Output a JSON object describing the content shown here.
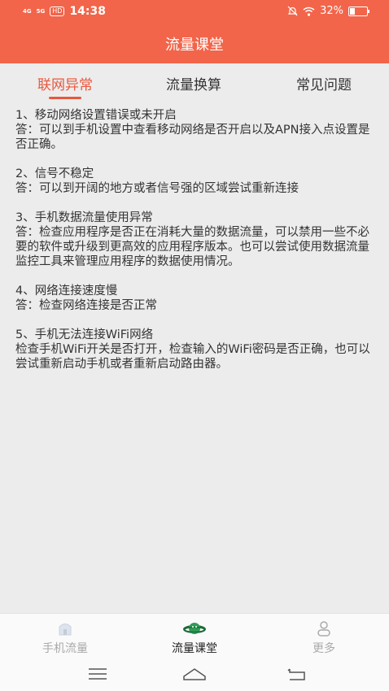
{
  "status_bar": {
    "signal1": "4G",
    "signal2": "5G",
    "hd": "HD",
    "time": "14:38",
    "battery": "32%",
    "battery_level": 0.32
  },
  "header": {
    "title": "流量课堂"
  },
  "tabs": [
    {
      "label": "联网异常",
      "active": true
    },
    {
      "label": "流量换算",
      "active": false
    },
    {
      "label": "常见问题",
      "active": false
    }
  ],
  "accent": "#f2654a",
  "content": [
    {
      "title": "1、移动网络设置错误或未开启",
      "answer": "答：可以到手机设置中查看移动网络是否开启以及APN接入点设置是否正确。"
    },
    {
      "title": "2、信号不稳定",
      "answer": "答：可以到开阔的地方或者信号强的区域尝试重新连接"
    },
    {
      "title": "3、手机数据流量使用异常",
      "answer": "答：检查应用程序是否正在消耗大量的数据流量，可以禁用一些不必要的软件或升级到更高效的应用程序版本。也可以尝试使用数据流量监控工具来管理应用程序的数据使用情况。"
    },
    {
      "title": "4、网络连接速度慢",
      "answer": "答：检查网络连接是否正常"
    },
    {
      "title": "5、手机无法连接WiFi网络",
      "answer": "检查手机WiFi开关是否打开，检查输入的WiFi密码是否正确，也可以尝试重新启动手机或者重新启动路由器。"
    }
  ],
  "bottom_nav": [
    {
      "label": "手机流量",
      "icon": "phone-data-icon",
      "active": false
    },
    {
      "label": "流量课堂",
      "icon": "planet-icon",
      "active": true
    },
    {
      "label": "更多",
      "icon": "user-icon",
      "active": false
    }
  ],
  "system_nav": [
    "menu-icon",
    "home-icon",
    "back-icon"
  ]
}
